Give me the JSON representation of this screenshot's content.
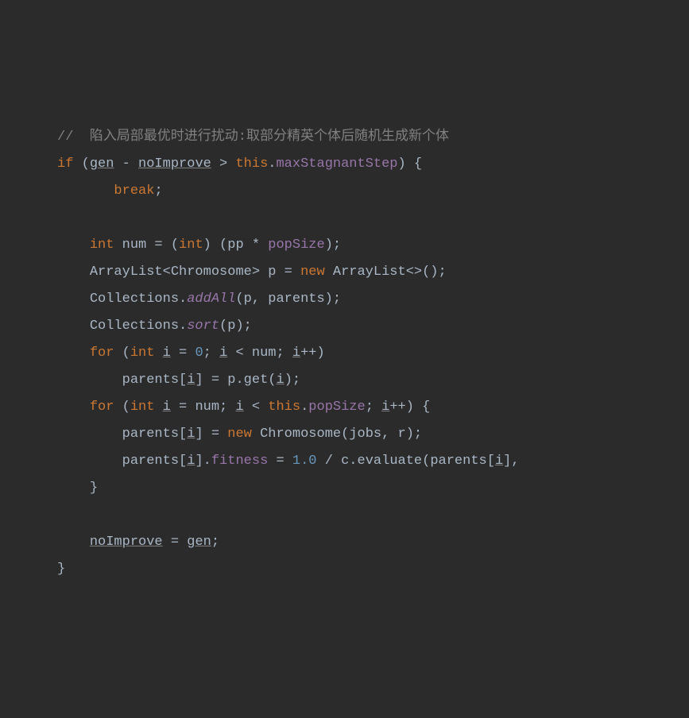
{
  "code": {
    "l1_comment": "//  陷入局部最优时进行扰动:取部分精英个体后随机生成新个体",
    "l2_if": "if",
    "l2_gen": "gen",
    "l2_minus": " - ",
    "l2_noImprove": "noImprove",
    "l2_gt": " > ",
    "l2_this": "this",
    "l2_dot": ".",
    "l2_maxStagnant": "maxStagnantStep",
    "l2_close": ") {",
    "l3_break": "break",
    "l3_semi": ";",
    "l5_int1": "int",
    "l5_num": " num = (",
    "l5_int2": "int",
    "l5_paren": ") (pp * ",
    "l5_popSize": "popSize",
    "l5_close": ");",
    "l6_arraylist": "ArrayList<Chromosome> p = ",
    "l6_new": "new",
    "l6_arraylist2": " ArrayList<>();",
    "l7_collections": "Collections.",
    "l7_addAll": "addAll",
    "l7_args": "(p, parents);",
    "l8_collections": "Collections.",
    "l8_sort": "sort",
    "l8_args": "(p);",
    "l9_for": "for",
    "l9_open": " (",
    "l9_int": "int",
    "l9_space": " ",
    "l9_i1": "i",
    "l9_eq": " = ",
    "l9_zero": "0",
    "l9_semi1": "; ",
    "l9_i2": "i",
    "l9_lt": " < num; ",
    "l9_i3": "i",
    "l9_inc": "++)",
    "l10_parents": "parents[",
    "l10_i": "i",
    "l10_close": "] = p.get(",
    "l10_i2": "i",
    "l10_end": ");",
    "l11_for": "for",
    "l11_open": " (",
    "l11_int": "int",
    "l11_space": " ",
    "l11_i1": "i",
    "l11_eq": " = num; ",
    "l11_i2": "i",
    "l11_lt": " < ",
    "l11_this": "this",
    "l11_dot": ".",
    "l11_popSize": "popSize",
    "l11_semi": "; ",
    "l11_i3": "i",
    "l11_inc": "++) {",
    "l12_parents": "parents[",
    "l12_i": "i",
    "l12_close": "] = ",
    "l12_new": "new",
    "l12_chrom": " Chromosome(jobs, r);",
    "l13_parents": "parents[",
    "l13_i1": "i",
    "l13_close": "].",
    "l13_fitness": "fitness",
    "l13_eq": " = ",
    "l13_one": "1.0",
    "l13_div": " / c.evaluate(parents[",
    "l13_i2": "i",
    "l13_end": "],",
    "l14_brace": "}",
    "l16_noImprove": "noImprove",
    "l16_eq": " = ",
    "l16_gen": "gen",
    "l16_semi": ";",
    "l17_brace": "}"
  }
}
